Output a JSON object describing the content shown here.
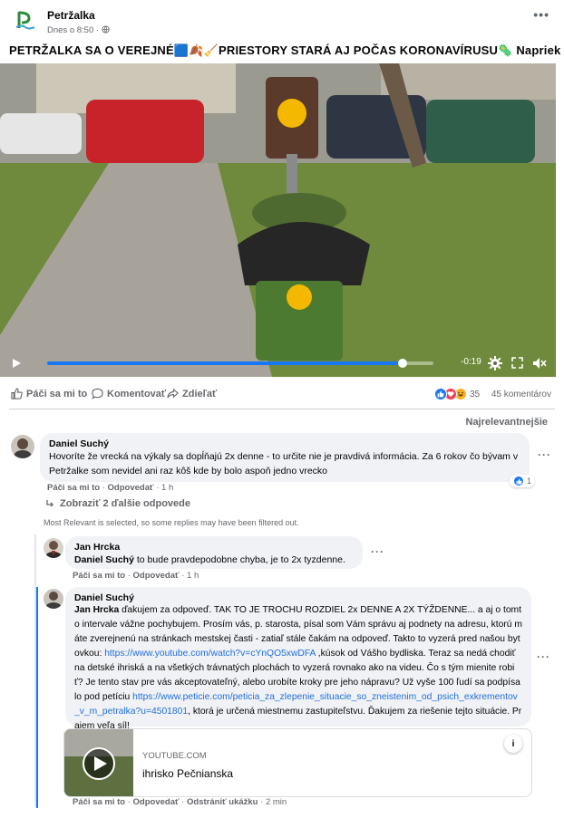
{
  "page": {
    "name": "Petržalka",
    "time": "Dnes o 8:50",
    "privacy_glyph": "·",
    "more": "•••"
  },
  "post": {
    "title": "PETRŽALKA SA O VEREJNÉ🟦🍂🧹PRIESTORY STARÁ AJ POČAS KORONAVÍRUSU🦠 Napriek ..."
  },
  "video": {
    "time_remaining": "-0:19",
    "progress_fraction": 0.92
  },
  "actions": {
    "like": "Páči sa mi to",
    "comment": "Komentovať",
    "share": "Zdieľať",
    "reaction_count": "35",
    "comment_count": "45 komentárov",
    "reaction_icons": [
      "like",
      "love",
      "haha"
    ]
  },
  "sort_label": "Najrelevantnejšie",
  "filter_note": "Most Relevant is selected, so some replies may have been filtered out.",
  "comments": [
    {
      "author": "Daniel Suchý",
      "text": "Hovoríte že vrecká na výkaly sa dopĺňajú 2x denne - to určite nie je pravdivá informácia. Za 6 rokov čo bývam v Petržalke som nevidel ani raz kôš kde by bolo aspoň jedno vrecko",
      "like": "Páči sa mi to",
      "reply": "Odpovedať",
      "age": "1 h",
      "like_count": "1",
      "more_replies": "Zobraziť 2 ďalšie odpovede"
    },
    {
      "author": "Jan Hrcka",
      "mention": "Daniel Suchý",
      "text": " to bude pravdepodobne chyba, je to 2x tyzdenne.",
      "like": "Páči sa mi to",
      "reply": "Odpovedať",
      "age": "1 h"
    },
    {
      "author": "Daniel Suchý",
      "mention": "Jan Hrcka",
      "text_1": " ďakujem za odpoveď. TAK TO JE TROCHU ROZDIEL 2x DENNE A 2X TÝŽDENNE... a aj o tomto intervale vážne pochybujem. Prosím vás, p. starosta, písal som Vám správu aj podnety na adresu, ktorú máte zverejnenú na stránkach mestskej časti - zatiaľ stále čakám na odpoveď. Takto to vyzerá pred našou bytovkou: ",
      "link_1": "https://www.youtube.com/watch?v=cYnQO5xwDFA",
      "text_2": " ,kúsok od Vášho bydliska. Teraz sa nedá chodiť na detské ihriská a na všetkých trávnatých plochách to vyzerá rovnako ako na videu. Čo s tým mienite robiť? Je tento stav pre vás akceptovateľný, alebo urobíte kroky pre jeho nápravu? Už vyše 100 ľudí sa podpísalo pod petíciu ",
      "link_2": "https://www.peticie.com/peticia_za_zlepenie_situacie_so_zneistenim_od_psich_exkrementov_v_m_petralka?u=4501801",
      "text_3": ", ktorá je určená miestnemu zastupiteľstvu. Ďakujem za riešenie tejto situácie. Prajem veľa síl!",
      "like": "Páči sa mi to",
      "reply": "Odpovedať",
      "remove_preview": "Odstrániť ukážku",
      "age": "2 min"
    }
  ],
  "link_preview": {
    "source": "YOUTUBE.COM",
    "title": "ihrisko Pečnianska",
    "info": "i"
  },
  "colors": {
    "link": "#216fdb",
    "like_blue": "#1877f2",
    "love_red": "#f33e58",
    "haha_yellow": "#f7b125",
    "bubble": "#f0f2f5",
    "brand_green": "#2e8b3e"
  }
}
